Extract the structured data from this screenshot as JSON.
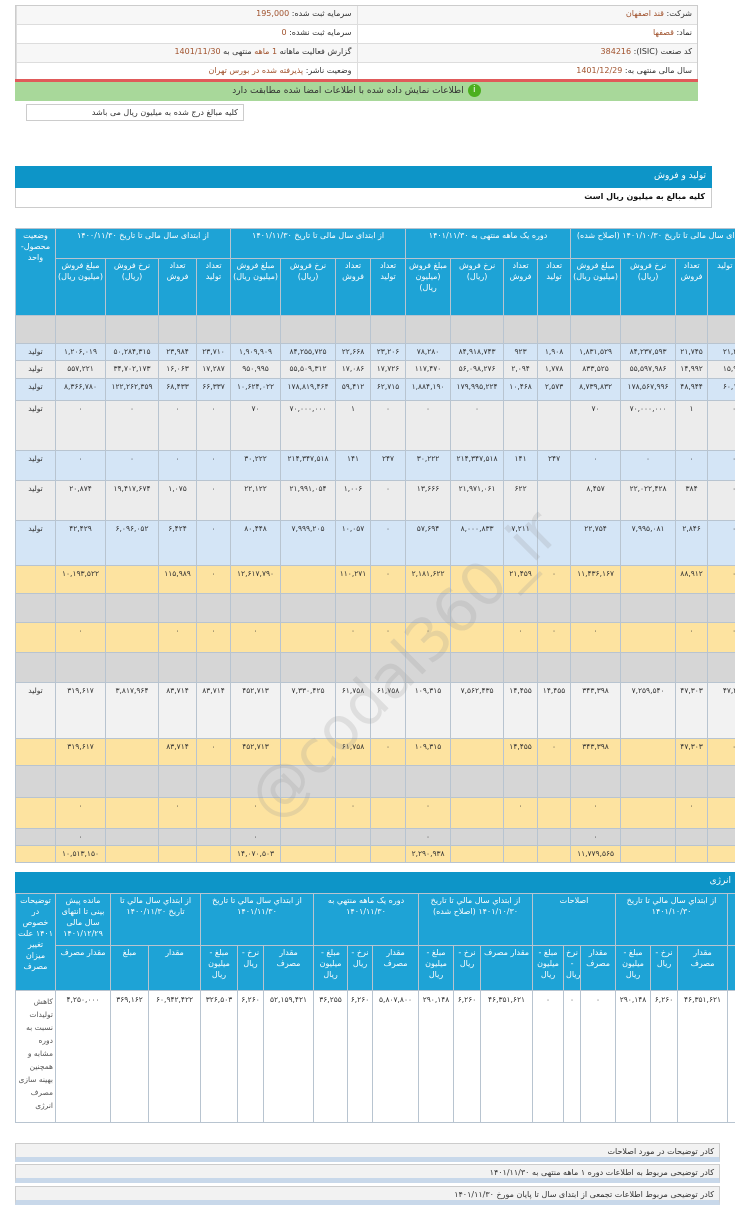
{
  "info": {
    "company_label": "شرکت:",
    "company": "قند اصفهان",
    "capital_label": "سرمایه ثبت شده:",
    "capital": "195,000",
    "symbol_label": "نماد:",
    "symbol": "قصفها",
    "unreg_capital_label": "سرمایه ثبت نشده:",
    "unreg_capital": "0",
    "isic_label": "کد صنعت (ISIC):",
    "isic": "384216",
    "report_label": "گزارش فعالیت ماهانه",
    "report_period": "1 ماهه",
    "report_end_label": "منتهی به",
    "report_end": "1401/11/30",
    "fy_label": "سال مالی منتهی به:",
    "fy": "1401/12/29",
    "status_label": "وضعیت ناشر:",
    "status": "پذیرفته شده در بورس تهران"
  },
  "verified_msg": "اطلاعات نمایش داده شده با اطلاعات امضا شده مطابقت دارد",
  "amounts_note": "کلیه مبالغ درج شده به میلیون ریال می باشد",
  "production": {
    "title": "تولید و فروش",
    "subtitle": "کلیه مبالغ به میلیون ریال است",
    "unit_header": "وضعیت محصول- واحد",
    "groups": [
      "از ابتدای سال مالی تا تاریخ ۱۴۰۰/۱۱/۳۰",
      "از ابتدای سال مالی تا تاریخ ۱۴۰۱/۱۱/۳۰",
      "دوره یک ماهه منتهی به ۱۴۰۱/۱۱/۳۰",
      "از ابتدای سال مالی تا تاریخ ۱۴۰۱/۱۰/۳۰ (اصلاح شده)"
    ],
    "subheaders": [
      "مبلغ فروش (میلیون ریال)",
      "نرخ فروش (ریال)",
      "تعداد فروش",
      "تعداد تولید"
    ],
    "rows": [
      {
        "style": "dk",
        "cells": [
          "",
          "",
          "",
          "",
          "",
          "",
          "",
          "",
          "",
          "",
          "",
          "",
          "",
          "",
          "",
          "",
          ""
        ]
      },
      {
        "style": "blue",
        "cells": [
          "تولید",
          "۱,۲۰۶,۰۱۹",
          "۵۰,۲۸۴,۳۱۵",
          "۲۳,۹۸۴",
          "۲۳,۷۱۰",
          "۱,۹۰۹,۹۰۹",
          "۸۴,۲۵۵,۷۲۵",
          "۲۲,۶۶۸",
          "۲۳,۲۰۶",
          "۷۸,۲۸۰",
          "۸۴,۹۱۸,۷۴۳",
          "۹۲۳",
          "۱,۹۰۸",
          "۱,۸۳۱,۵۲۹",
          "۸۴,۲۳۷,۵۹۳",
          "۲۱,۷۴۵",
          "۲۱,۲۹۸"
        ]
      },
      {
        "style": "gray",
        "cells": [
          "تولید",
          "۵۵۷,۲۲۱",
          "۳۴,۷۰۲,۱۷۳",
          "۱۶,۰۶۳",
          "۱۷,۲۸۷",
          "۹۵۰,۹۹۵",
          "۵۵,۵۰۹,۳۱۲",
          "۱۷,۰۸۶",
          "۱۷,۷۲۶",
          "۱۱۷,۴۷۰",
          "۵۶,۰۹۸,۲۷۶",
          "۲,۰۹۴",
          "۱,۷۷۸",
          "۸۳۳,۵۲۵",
          "۵۵,۵۹۷,۹۸۶",
          "۱۴,۹۹۲",
          "۱۵,۹۴۸"
        ]
      },
      {
        "style": "blue",
        "cells": [
          "تولید",
          "۸,۳۶۶,۷۸۰",
          "۱۲۲,۲۶۲,۳۵۹",
          "۶۸,۴۳۳",
          "۶۶,۳۳۷",
          "۱۰,۶۲۴,۰۲۲",
          "۱۷۸,۸۱۹,۴۶۴",
          "۵۹,۴۱۲",
          "۶۲,۷۱۵",
          "۱,۸۸۴,۱۹۰",
          "۱۷۹,۹۹۵,۲۲۴",
          "۱۰,۴۶۸",
          "۲,۵۷۳",
          "۸,۷۳۹,۸۳۲",
          "۱۷۸,۵۶۷,۹۹۶",
          "۴۸,۹۴۴",
          "۶۰,۱۴۲"
        ]
      },
      {
        "style": "gray",
        "cells": [
          "تولید",
          "۰",
          "۰",
          "۰",
          "۰",
          "۷۰",
          "۷۰,۰۰۰,۰۰۰",
          "۱",
          "۰",
          "۰",
          "۰",
          "",
          "",
          "۷۰",
          "۷۰,۰۰۰,۰۰۰",
          "۱",
          "۰"
        ]
      },
      {
        "style": "blue",
        "cells": [
          "تولید",
          "۰",
          "۰",
          "۰",
          "۰",
          "۳۰,۲۲۲",
          "۲۱۴,۳۴۷,۵۱۸",
          "۱۴۱",
          "۲۴۷",
          "۳۰,۲۲۲",
          "۲۱۴,۳۴۷,۵۱۸",
          "۱۴۱",
          "۲۴۷",
          "۰",
          "۰",
          "۰",
          "۰"
        ]
      },
      {
        "style": "gray",
        "cells": [
          "تولید",
          "۲۰,۸۷۴",
          "۱۹,۴۱۷,۶۷۴",
          "۱,۰۷۵",
          "۰",
          "۲۲,۱۲۲",
          "۲۱,۹۹۱,۰۵۴",
          "۱,۰۰۶",
          "۰",
          "۱۳,۶۶۶",
          "۲۱,۹۷۱,۰۶۱",
          "۶۲۲",
          "",
          "۸,۴۵۷",
          "۲۲,۰۲۲,۴۲۸",
          "۳۸۴",
          "۰"
        ]
      },
      {
        "style": "blue",
        "cells": [
          "تولید",
          "۴۲,۴۲۹",
          "۶,۰۹۶,۰۵۲",
          "۶,۴۲۴",
          "۰",
          "۸۰,۴۴۸",
          "۷,۹۹۹,۲۰۵",
          "۱۰,۰۵۷",
          "۰",
          "۵۷,۶۹۴",
          "۸,۰۰۰,۸۳۳",
          "۷,۲۱۱",
          "",
          "۲۲,۷۵۴",
          "۷,۹۹۵,۰۸۱",
          "۲,۸۴۶",
          "۰"
        ]
      },
      {
        "style": "yl",
        "cells": [
          "",
          "۱۰,۱۹۳,۵۲۲",
          "",
          "۱۱۵,۹۸۹",
          "۰",
          "۱۲,۶۱۷,۷۹۰",
          "",
          "۱۱۰,۲۷۱",
          "۰",
          "۲,۱۸۱,۶۲۲",
          "",
          "۲۱,۴۵۹",
          "۰",
          "۱۱,۴۳۶,۱۶۷",
          "",
          "۸۸,۹۱۲",
          "۰"
        ]
      },
      {
        "style": "dk",
        "cells": [
          "",
          "",
          "",
          "",
          "",
          "",
          "",
          "",
          "",
          "",
          "",
          "",
          "",
          "",
          "",
          "",
          ""
        ]
      },
      {
        "style": "yl",
        "cells": [
          "",
          "۰",
          "",
          "۰",
          "۰",
          "۰",
          "",
          "۰",
          "۰",
          "۰",
          "",
          "۰",
          "۰",
          "۰",
          "",
          "۰",
          "۰"
        ]
      },
      {
        "style": "dk",
        "cells": [
          "",
          "",
          "",
          "",
          "",
          "",
          "",
          "",
          "",
          "",
          "",
          "",
          "",
          "",
          "",
          "",
          ""
        ]
      },
      {
        "style": "wh",
        "cells": [
          "تولید",
          "۳۱۹,۶۱۷",
          "۳,۸۱۷,۹۶۴",
          "۸۳,۷۱۴",
          "۸۳,۷۱۴",
          "۴۵۲,۷۱۳",
          "۷,۳۳۰,۴۲۵",
          "۶۱,۷۵۸",
          "۶۱,۷۵۸",
          "۱۰۹,۳۱۵",
          "۷,۵۶۲,۴۳۵",
          "۱۴,۴۵۵",
          "۱۴,۴۵۵",
          "۳۴۳,۳۹۸",
          "۷,۲۵۹,۵۴۰",
          "۴۷,۳۰۳",
          "۴۷,۳۰۲"
        ]
      },
      {
        "style": "yl",
        "cells": [
          "",
          "۳۱۹,۶۱۷",
          "",
          "۸۳,۷۱۴",
          "۰",
          "۴۵۲,۷۱۳",
          "",
          "۶۱,۷۵۸",
          "۰",
          "۱۰۹,۳۱۵",
          "",
          "۱۴,۴۵۵",
          "۰",
          "۳۴۳,۳۹۸",
          "",
          "۴۷,۳۰۳",
          "۰"
        ]
      },
      {
        "style": "dk",
        "cells": [
          "",
          "",
          "",
          "",
          "",
          "",
          "",
          "",
          "",
          "",
          "",
          "",
          "",
          "",
          "",
          "",
          ""
        ]
      },
      {
        "style": "yl",
        "cells": [
          "",
          "۰",
          "",
          "۰",
          "",
          "۰",
          "",
          "۰",
          "",
          "۰",
          "",
          "۰",
          "",
          "۰",
          "",
          "۰",
          ""
        ]
      },
      {
        "style": "dk",
        "cells": [
          "",
          "۰",
          "",
          "",
          "",
          "۰",
          "",
          "",
          "",
          "۰",
          "",
          "",
          "",
          "۰",
          "",
          "",
          ""
        ]
      },
      {
        "style": "yl",
        "cells": [
          "",
          "۱۰,۵۱۳,۱۵۰",
          "",
          "",
          "",
          "۱۴,۰۷۰,۵۰۳",
          "",
          "",
          "",
          "۲,۲۹۰,۹۳۸",
          "",
          "",
          "",
          "۱۱,۷۷۹,۵۶۵",
          "",
          "",
          ""
        ]
      }
    ]
  },
  "energy": {
    "title": "انرژی",
    "groups": [
      "توضیحات در خصوص ۱۴۰۱ علت تغییر میزان مصرف",
      "مانده پیش بینی تا انتهای سال مالی ۱۴۰۱/۱۲/۲۹",
      "از ابتداي سال مالي تا تاریخ ۱۴۰۰/۱۱/۳۰",
      "از ابتداي سال مالي تا تاریخ ۱۴۰۱/۱۱/۳۰",
      "دوره یک ماهه منتهي به ۱۴۰۱/۱۱/۳۰",
      "از ابتداي سال مالي تا تاریخ ۱۴۰۱/۱۰/۳۰ (اصلاح شده)",
      "اصلاحات",
      "از ابتداي سال مالي تا تاریخ ۱۴۰۱/۱۰/۳۰",
      ""
    ],
    "subheaders": [
      "مقدار مصرف",
      "مبلغ",
      "مقدار",
      "مبلغ - میلیون ریال",
      "نرخ - ریال",
      "مقدار مصرف",
      "مبلغ - میلیون ریال",
      "نرخ - ریال",
      "مقدار مصرف",
      "مبلغ - میلیون ریال",
      "نرخ - ریال",
      "مقدار مصرف",
      "مبلغ - میلیون ریال",
      "نرخ - ریال",
      "مقدار مصرف",
      "مبلغ - میلیون ریال",
      "نرخ - ریال",
      "مقدار مصرف",
      ""
    ],
    "row": [
      "کاهش تولیدات نسبت به دوره مشابه و همچنین بهینه سازی مصرف انرژی",
      "۴,۲۵۰,۰۰۰",
      "۳۶۹,۱۶۲",
      "۶۰,۹۴۲,۴۲۲",
      "۳۲۶,۵۰۳",
      "۶,۲۶۰",
      "۵۲,۱۵۹,۴۲۱",
      "۳۶,۲۵۵",
      "۶,۲۶۰",
      "۵,۸۰۷,۸۰۰",
      "۲۹۰,۱۴۸",
      "۶,۲۶۰",
      "۴۶,۳۵۱,۶۲۱",
      "۰",
      "۰",
      "۰",
      "۲۹۰,۱۴۸",
      "۶,۲۶۰",
      "۴۶,۳۵۱,۶۲۱",
      "ب"
    ]
  },
  "boxes": [
    "کادر توضیحات در مورد اصلاحات",
    "کادر توضیحی مربوط به اطلاعات دوره ۱ ماهه منتهی به ۱۴۰۱/۱۱/۳۰",
    "کادر توضیحی مربوط اطلاعات تجمعی از ابتدای سال تا پایان مورخ ۱۴۰۱/۱۱/۳۰"
  ],
  "watermark": "@codal360_ir",
  "colors": {
    "header": "#0d95c8",
    "verified": "#a8d89a",
    "subtotal": "#fde3a0"
  }
}
